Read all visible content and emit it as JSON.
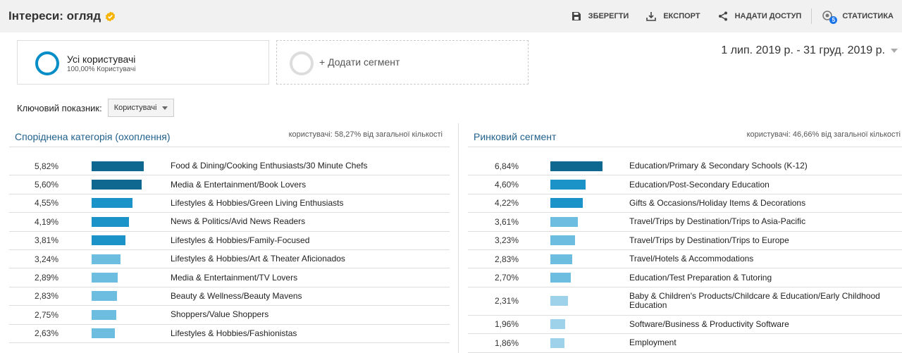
{
  "header": {
    "title": "Інтереси: огляд",
    "save": "ЗБЕРЕГТИ",
    "export": "ЕКСПОРТ",
    "share": "НАДАТИ ДОСТУП",
    "stats": "СТАТИСТИКА",
    "stats_badge": "5"
  },
  "segments": {
    "all_name": "Усі користувачі",
    "all_sub": "100,00% Користувачі",
    "add_label": "+ Додати сегмент"
  },
  "date_range": "1 лип. 2019 р. - 31 груд. 2019 р.",
  "metric": {
    "label": "Ключовий показник:",
    "value": "Користувачі"
  },
  "colors": {
    "dark": "#0e6890",
    "mid": "#1b93c9",
    "light": "#6cbde0",
    "lighter": "#9dd2ea"
  },
  "left_panel": {
    "title": "Споріднена категорія (охоплення)",
    "subtitle": "користувачі: 58,27% від загальної кількості",
    "rows": [
      {
        "pct": "5,82%",
        "value": 5.82,
        "label": "Food & Dining/Cooking Enthusiasts/30 Minute Chefs"
      },
      {
        "pct": "5,60%",
        "value": 5.6,
        "label": "Media & Entertainment/Book Lovers"
      },
      {
        "pct": "4,55%",
        "value": 4.55,
        "label": "Lifestyles & Hobbies/Green Living Enthusiasts"
      },
      {
        "pct": "4,19%",
        "value": 4.19,
        "label": "News & Politics/Avid News Readers"
      },
      {
        "pct": "3,81%",
        "value": 3.81,
        "label": "Lifestyles & Hobbies/Family-Focused"
      },
      {
        "pct": "3,24%",
        "value": 3.24,
        "label": "Lifestyles & Hobbies/Art & Theater Aficionados"
      },
      {
        "pct": "2,89%",
        "value": 2.89,
        "label": "Media & Entertainment/TV Lovers"
      },
      {
        "pct": "2,83%",
        "value": 2.83,
        "label": "Beauty & Wellness/Beauty Mavens"
      },
      {
        "pct": "2,75%",
        "value": 2.75,
        "label": "Shoppers/Value Shoppers"
      },
      {
        "pct": "2,63%",
        "value": 2.63,
        "label": "Lifestyles & Hobbies/Fashionistas"
      }
    ]
  },
  "right_panel": {
    "title": "Ринковий сегмент",
    "subtitle": "користувачі: 46,66% від загальної кількості",
    "rows": [
      {
        "pct": "6,84%",
        "value": 6.84,
        "label": "Education/Primary & Secondary Schools (K-12)"
      },
      {
        "pct": "4,60%",
        "value": 4.6,
        "label": "Education/Post-Secondary Education"
      },
      {
        "pct": "4,22%",
        "value": 4.22,
        "label": "Gifts & Occasions/Holiday Items & Decorations"
      },
      {
        "pct": "3,61%",
        "value": 3.61,
        "label": "Travel/Trips by Destination/Trips to Asia-Pacific"
      },
      {
        "pct": "3,23%",
        "value": 3.23,
        "label": "Travel/Trips by Destination/Trips to Europe"
      },
      {
        "pct": "2,83%",
        "value": 2.83,
        "label": "Travel/Hotels & Accommodations"
      },
      {
        "pct": "2,70%",
        "value": 2.7,
        "label": "Education/Test Preparation & Tutoring"
      },
      {
        "pct": "2,31%",
        "value": 2.31,
        "label": "Baby & Children's Products/Childcare & Education/Early Childhood Education"
      },
      {
        "pct": "1,96%",
        "value": 1.96,
        "label": "Software/Business & Productivity Software"
      },
      {
        "pct": "1,86%",
        "value": 1.86,
        "label": "Employment"
      }
    ]
  }
}
